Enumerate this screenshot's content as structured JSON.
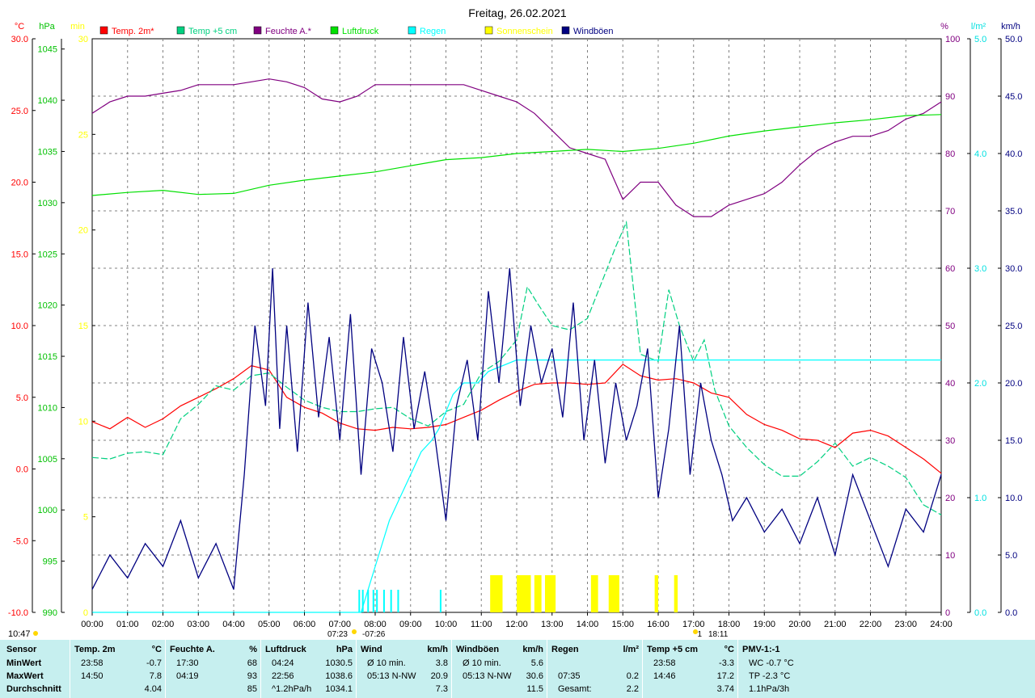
{
  "chart_data": {
    "type": "line",
    "title": "Freitag, 26.02.2021",
    "x_ticks": [
      "00:00",
      "01:00",
      "02:00",
      "03:00",
      "04:00",
      "05:00",
      "06:00",
      "07:00",
      "08:00",
      "09:00",
      "10:00",
      "11:00",
      "12:00",
      "13:00",
      "14:00",
      "15:00",
      "16:00",
      "17:00",
      "18:00",
      "19:00",
      "20:00",
      "21:00",
      "22:00",
      "23:00",
      "24:00"
    ],
    "axes": {
      "temp": {
        "unit": "°C",
        "color": "#ff0000",
        "min": -10,
        "max": 30,
        "ticks": [
          "30.0",
          "25.0",
          "20.0",
          "15.0",
          "10.0",
          "5.0",
          "0.0",
          "-5.0",
          "-10.0"
        ]
      },
      "pressure": {
        "unit": "hPa",
        "color": "#00c000",
        "min": 990,
        "max": 1046,
        "ticks": [
          "1045",
          "1040",
          "1035",
          "1030",
          "1025",
          "1020",
          "1015",
          "1010",
          "1005",
          "1000",
          "995",
          "990"
        ]
      },
      "sunshine": {
        "unit": "min",
        "color": "#ffff00",
        "min": 0,
        "max": 30,
        "ticks": [
          "30",
          "25",
          "20",
          "15",
          "10",
          "5",
          "0"
        ]
      },
      "humidity": {
        "unit": "%",
        "color": "#800080",
        "min": 0,
        "max": 100,
        "ticks": [
          "100",
          "90",
          "80",
          "70",
          "60",
          "50",
          "40",
          "30",
          "20",
          "10",
          "0"
        ]
      },
      "rain": {
        "unit": "l/m²",
        "color": "#00e0e0",
        "min": 0,
        "max": 5,
        "ticks": [
          "5.0",
          "4.0",
          "3.0",
          "2.0",
          "1.0",
          "0.0"
        ]
      },
      "wind": {
        "unit": "km/h",
        "color": "#000080",
        "min": 0,
        "max": 50,
        "ticks": [
          "50.0",
          "45.0",
          "40.0",
          "35.0",
          "30.0",
          "25.0",
          "20.0",
          "15.0",
          "10.0",
          "5.0",
          "0.0"
        ]
      }
    },
    "legend": [
      {
        "name": "Temp. 2m*",
        "color": "#ff0000"
      },
      {
        "name": "Temp +5 cm",
        "color": "#00d080"
      },
      {
        "name": "Feuchte A.*",
        "color": "#800080"
      },
      {
        "name": "Luftdruck",
        "color": "#00e000"
      },
      {
        "name": "Regen",
        "color": "#00ffff"
      },
      {
        "name": "Sonnenschein",
        "color": "#ffff00"
      },
      {
        "name": "Windböen",
        "color": "#000080"
      }
    ],
    "series": [
      {
        "name": "Temp. 2m*",
        "axis": "temp",
        "color": "#ff0000",
        "x": [
          0,
          0.5,
          1,
          1.5,
          2,
          2.5,
          3,
          3.5,
          4,
          4.5,
          5,
          5.5,
          6,
          6.5,
          7,
          7.5,
          8,
          8.5,
          9,
          9.5,
          10,
          10.5,
          11,
          11.5,
          12,
          12.5,
          13,
          13.5,
          14,
          14.5,
          15,
          15.5,
          16,
          16.5,
          17,
          17.5,
          18,
          18.5,
          19,
          19.5,
          20,
          20.5,
          21,
          21.5,
          22,
          22.5,
          23,
          23.5,
          24
        ],
        "y": [
          3.3,
          2.8,
          3.6,
          2.9,
          3.5,
          4.4,
          5.0,
          5.6,
          6.3,
          7.2,
          6.9,
          5.0,
          4.3,
          3.9,
          3.2,
          2.8,
          2.7,
          2.9,
          2.8,
          2.9,
          3.1,
          3.6,
          4.1,
          4.8,
          5.4,
          5.9,
          6.0,
          6.0,
          5.9,
          6.0,
          7.3,
          6.5,
          6.2,
          6.3,
          6.0,
          5.3,
          5.0,
          3.8,
          3.1,
          2.7,
          2.1,
          2.0,
          1.5,
          2.5,
          2.7,
          2.3,
          1.5,
          0.7,
          -0.3
        ]
      },
      {
        "name": "Temp +5 cm",
        "axis": "temp",
        "color": "#00d080",
        "x": [
          0,
          0.5,
          1,
          1.5,
          2,
          2.5,
          3,
          3.5,
          4,
          4.5,
          5,
          5.5,
          6,
          6.5,
          7,
          7.5,
          8,
          8.5,
          9,
          9.5,
          10,
          10.5,
          11,
          11.5,
          12,
          12.3,
          12.6,
          13,
          13.5,
          14,
          14.4,
          14.8,
          15.1,
          15.5,
          16,
          16.3,
          16.6,
          17,
          17.3,
          17.6,
          18,
          18.5,
          19,
          19.5,
          20,
          20.5,
          21,
          21.5,
          22,
          22.5,
          23,
          23.5,
          24
        ],
        "y": [
          0.8,
          0.7,
          1.1,
          1.2,
          1.0,
          3.5,
          4.5,
          5.8,
          5.5,
          6.5,
          6.7,
          5.7,
          4.8,
          4.3,
          4.0,
          4.0,
          4.2,
          4.3,
          3.5,
          3.0,
          4.0,
          4.5,
          6.7,
          7.5,
          9.0,
          12.7,
          11.5,
          10.0,
          9.7,
          10.5,
          13.0,
          15.5,
          17.2,
          8.0,
          7.5,
          12.5,
          10.0,
          7.5,
          9.0,
          5.5,
          3.0,
          1.5,
          0.3,
          -0.5,
          -0.5,
          0.5,
          1.8,
          0.2,
          0.8,
          0.2,
          -0.6,
          -2.5,
          -3.2
        ]
      },
      {
        "name": "Feuchte A.*",
        "axis": "humidity",
        "color": "#800080",
        "x": [
          0,
          0.5,
          1,
          1.5,
          2,
          2.5,
          3,
          3.5,
          4,
          4.5,
          5,
          5.5,
          6,
          6.5,
          7,
          7.5,
          8,
          8.5,
          9,
          9.5,
          10,
          10.5,
          11,
          11.5,
          12,
          12.5,
          13,
          13.5,
          14,
          14.5,
          15,
          15.5,
          16,
          16.5,
          17,
          17.5,
          18,
          18.5,
          19,
          19.5,
          20,
          20.5,
          21,
          21.5,
          22,
          22.5,
          23,
          23.5,
          24
        ],
        "y": [
          87,
          89,
          90,
          90,
          90.5,
          91,
          92,
          92,
          92,
          92.5,
          93,
          92.5,
          91.5,
          89.5,
          89,
          90,
          92,
          92,
          92,
          92,
          92,
          92,
          91,
          90,
          89,
          87,
          84,
          81,
          80,
          79,
          72,
          75,
          75,
          71,
          69,
          69,
          71,
          72,
          73,
          75,
          78,
          80.5,
          82,
          83,
          83,
          84,
          86,
          87,
          89
        ]
      },
      {
        "name": "Luftdruck",
        "axis": "pressure",
        "color": "#00e000",
        "x": [
          0,
          1,
          2,
          3,
          4,
          5,
          6,
          7,
          8,
          9,
          10,
          11,
          12,
          13,
          14,
          15,
          16,
          17,
          18,
          19,
          20,
          21,
          22,
          23,
          24
        ],
        "y": [
          1030.7,
          1031.0,
          1031.2,
          1030.8,
          1030.9,
          1031.7,
          1032.2,
          1032.6,
          1033.0,
          1033.6,
          1034.2,
          1034.4,
          1034.8,
          1035.0,
          1035.2,
          1035.0,
          1035.3,
          1035.8,
          1036.5,
          1037.0,
          1037.4,
          1037.8,
          1038.1,
          1038.5,
          1038.6
        ]
      },
      {
        "name": "Regen",
        "axis": "rain",
        "color": "#00ffff",
        "x": [
          0,
          7.6,
          7.8,
          8.1,
          8.4,
          8.7,
          9.0,
          9.3,
          9.6,
          9.8,
          10.2,
          10.5,
          10.9,
          11.2,
          12,
          13,
          14,
          15,
          16,
          17,
          18,
          19,
          20,
          21,
          22,
          23,
          24
        ],
        "y": [
          0,
          0,
          0.2,
          0.5,
          0.8,
          1.0,
          1.2,
          1.4,
          1.5,
          1.6,
          1.9,
          2.0,
          2.0,
          2.1,
          2.2,
          2.2,
          2.2,
          2.2,
          2.2,
          2.2,
          2.2,
          2.2,
          2.2,
          2.2,
          2.2,
          2.2,
          2.2
        ]
      },
      {
        "name": "Windböen",
        "axis": "wind",
        "color": "#000080",
        "x": [
          0,
          0.5,
          1,
          1.5,
          2,
          2.5,
          3,
          3.5,
          4,
          4.3,
          4.6,
          4.9,
          5.1,
          5.3,
          5.5,
          5.8,
          6.1,
          6.4,
          6.7,
          7.0,
          7.3,
          7.6,
          7.9,
          8.2,
          8.5,
          8.8,
          9.1,
          9.4,
          9.7,
          10.0,
          10.3,
          10.6,
          10.9,
          11.2,
          11.5,
          11.8,
          12.1,
          12.4,
          12.7,
          13.0,
          13.3,
          13.6,
          13.9,
          14.2,
          14.5,
          14.8,
          15.1,
          15.4,
          15.7,
          16.0,
          16.3,
          16.6,
          16.9,
          17.2,
          17.5,
          17.8,
          18.1,
          18.5,
          19.0,
          19.5,
          20.0,
          20.5,
          21.0,
          21.5,
          22.0,
          22.5,
          23.0,
          23.5,
          24.0
        ],
        "y": [
          2,
          5,
          3,
          6,
          4,
          8,
          3,
          6,
          2,
          12,
          25,
          18,
          30,
          16,
          25,
          14,
          27,
          17,
          24,
          15,
          26,
          12,
          23,
          20,
          14,
          24,
          16,
          21,
          15,
          8,
          18,
          22,
          15,
          28,
          20,
          30,
          18,
          25,
          20,
          23,
          17,
          27,
          15,
          22,
          13,
          20,
          15,
          18,
          23,
          10,
          16,
          25,
          12,
          20,
          15,
          12,
          8,
          10,
          7,
          9,
          6,
          10,
          5,
          12,
          8,
          4,
          9,
          7,
          12
        ]
      }
    ],
    "sunshine_bars": [
      {
        "x0": 11.25,
        "x1": 11.6
      },
      {
        "x0": 12.0,
        "x1": 12.4
      },
      {
        "x0": 12.5,
        "x1": 12.7
      },
      {
        "x0": 12.8,
        "x1": 13.1
      },
      {
        "x0": 14.1,
        "x1": 14.3
      },
      {
        "x0": 14.6,
        "x1": 14.9
      },
      {
        "x0": 15.9,
        "x1": 16.0
      },
      {
        "x0": 16.45,
        "x1": 16.55
      }
    ],
    "rain_bars": [
      7.55,
      7.65,
      7.8,
      7.95,
      8.05,
      8.25,
      8.45,
      8.65,
      9.85
    ],
    "sun_markers": {
      "sunrise": "07:23",
      "sunrise2": "07:26",
      "sunset_a": "1",
      "sunset": "18:11"
    },
    "time_label": "10:47"
  },
  "stats": {
    "columns": [
      {
        "header": "Sensor",
        "rows": [
          "MinWert",
          "MaxWert",
          "Durchschnitt"
        ]
      },
      {
        "header": "Temp. 2m",
        "unit": "°C",
        "rows": [
          [
            "23:58",
            "-0.7"
          ],
          [
            "14:50",
            "7.8"
          ],
          [
            "",
            "4.04"
          ]
        ]
      },
      {
        "header": "Feuchte A.",
        "unit": "%",
        "rows": [
          [
            "17:30",
            "68"
          ],
          [
            "04:19",
            "93"
          ],
          [
            "",
            "85"
          ]
        ]
      },
      {
        "header": "Luftdruck",
        "unit": "hPa",
        "rows": [
          [
            "04:24",
            "1030.5"
          ],
          [
            "22:56",
            "1038.6"
          ],
          [
            "^1.2hPa/h",
            "1034.1"
          ]
        ]
      },
      {
        "header": "Wind",
        "unit": "km/h",
        "rows": [
          [
            "Ø 10 min.",
            "3.8"
          ],
          [
            "05:13   N-NW",
            "20.9"
          ],
          [
            "",
            "7.3"
          ]
        ]
      },
      {
        "header": "Windböen",
        "unit": "km/h",
        "rows": [
          [
            "Ø 10 min.",
            "5.6"
          ],
          [
            "05:13   N-NW",
            "30.6"
          ],
          [
            "",
            "11.5"
          ]
        ]
      },
      {
        "header": "Regen",
        "unit": "l/m²",
        "rows": [
          [
            "",
            ""
          ],
          [
            "07:35",
            "0.2"
          ],
          [
            "Gesamt:",
            "2.2"
          ]
        ]
      },
      {
        "header": "Temp +5 cm",
        "unit": "°C",
        "rows": [
          [
            "23:58",
            "-3.3"
          ],
          [
            "14:46",
            "17.2"
          ],
          [
            "",
            "3.74"
          ]
        ]
      },
      {
        "header": "PMV-1:-1",
        "unit": "",
        "rows": [
          [
            "WC -0.7 °C",
            ""
          ],
          [
            "TP -2.3 °C",
            ""
          ],
          [
            "1.1hPa/3h",
            ""
          ]
        ]
      }
    ]
  }
}
